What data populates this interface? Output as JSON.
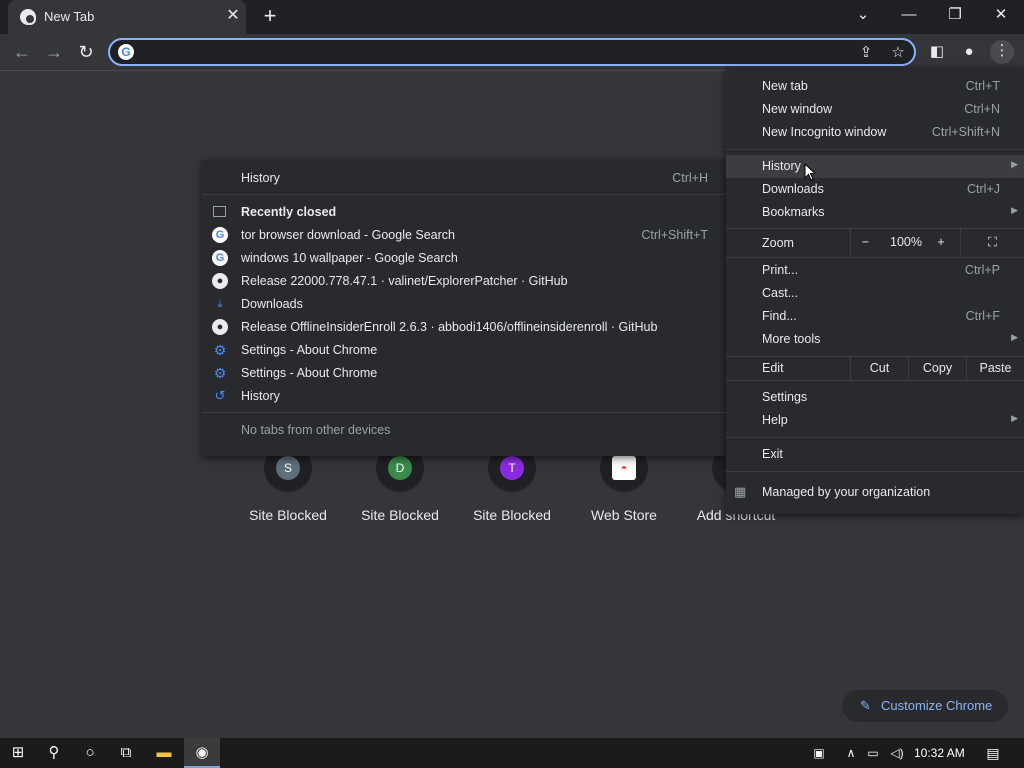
{
  "tab": {
    "title": "New Tab",
    "close": "✕",
    "new_tab": "+"
  },
  "window_controls": {
    "dropdown": "⌄",
    "minimize": "—",
    "restore": "❐",
    "close": "✕"
  },
  "toolbar": {
    "back": "←",
    "forward": "→",
    "reload": "↻"
  },
  "omnibox": {
    "value": "",
    "placeholder": ""
  },
  "shortcuts": [
    {
      "label": "Site Blocked",
      "letter": "S",
      "color": "#5f6f7a"
    },
    {
      "label": "Site Blocked",
      "letter": "D",
      "color": "#3a8a4a"
    },
    {
      "label": "Site Blocked",
      "letter": "T",
      "color": "#8a2be2"
    },
    {
      "label": "Web Store",
      "letter": "",
      "color": "#ffffff"
    },
    {
      "label": "Add shortcut",
      "letter": "",
      "color": "#202124"
    }
  ],
  "history_menu": {
    "header": {
      "label": "History",
      "shortcut": "Ctrl+H"
    },
    "recently_closed": "Recently closed",
    "items": [
      {
        "label": "tor browser download - Google Search",
        "shortcut": "Ctrl+Shift+T",
        "icon": "google-icon"
      },
      {
        "label": "windows 10 wallpaper - Google Search",
        "shortcut": "",
        "icon": "google-icon"
      },
      {
        "label": "Release 22000.778.47.1 · valinet/ExplorerPatcher · GitHub",
        "shortcut": "",
        "icon": "github-icon"
      },
      {
        "label": "Downloads",
        "shortcut": "",
        "icon": "download-icon"
      },
      {
        "label": "Release OfflineInsiderEnroll 2.6.3 · abbodi1406/offlineinsiderenroll · GitHub",
        "shortcut": "",
        "icon": "github-icon"
      },
      {
        "label": "Settings - About Chrome",
        "shortcut": "",
        "icon": "settings-icon"
      },
      {
        "label": "Settings - About Chrome",
        "shortcut": "",
        "icon": "settings-icon"
      },
      {
        "label": "History",
        "shortcut": "",
        "icon": "history-icon"
      }
    ],
    "no_tabs": "No tabs from other devices"
  },
  "main_menu": {
    "new_tab": {
      "label": "New tab",
      "shortcut": "Ctrl+T"
    },
    "new_window": {
      "label": "New window",
      "shortcut": "Ctrl+N"
    },
    "incognito": {
      "label": "New Incognito window",
      "shortcut": "Ctrl+Shift+N"
    },
    "history": {
      "label": "History"
    },
    "downloads": {
      "label": "Downloads",
      "shortcut": "Ctrl+J"
    },
    "bookmarks": {
      "label": "Bookmarks"
    },
    "zoom": {
      "label": "Zoom",
      "minus": "−",
      "value": "100%",
      "plus": "+"
    },
    "print": {
      "label": "Print...",
      "shortcut": "Ctrl+P"
    },
    "cast": {
      "label": "Cast..."
    },
    "find": {
      "label": "Find...",
      "shortcut": "Ctrl+F"
    },
    "more_tools": {
      "label": "More tools"
    },
    "edit": {
      "label": "Edit",
      "cut": "Cut",
      "copy": "Copy",
      "paste": "Paste"
    },
    "settings": {
      "label": "Settings"
    },
    "help": {
      "label": "Help"
    },
    "exit": {
      "label": "Exit"
    },
    "managed": {
      "label": "Managed by your organization"
    }
  },
  "customize": {
    "label": "Customize Chrome"
  },
  "taskbar": {
    "time": "10:32 AM"
  }
}
